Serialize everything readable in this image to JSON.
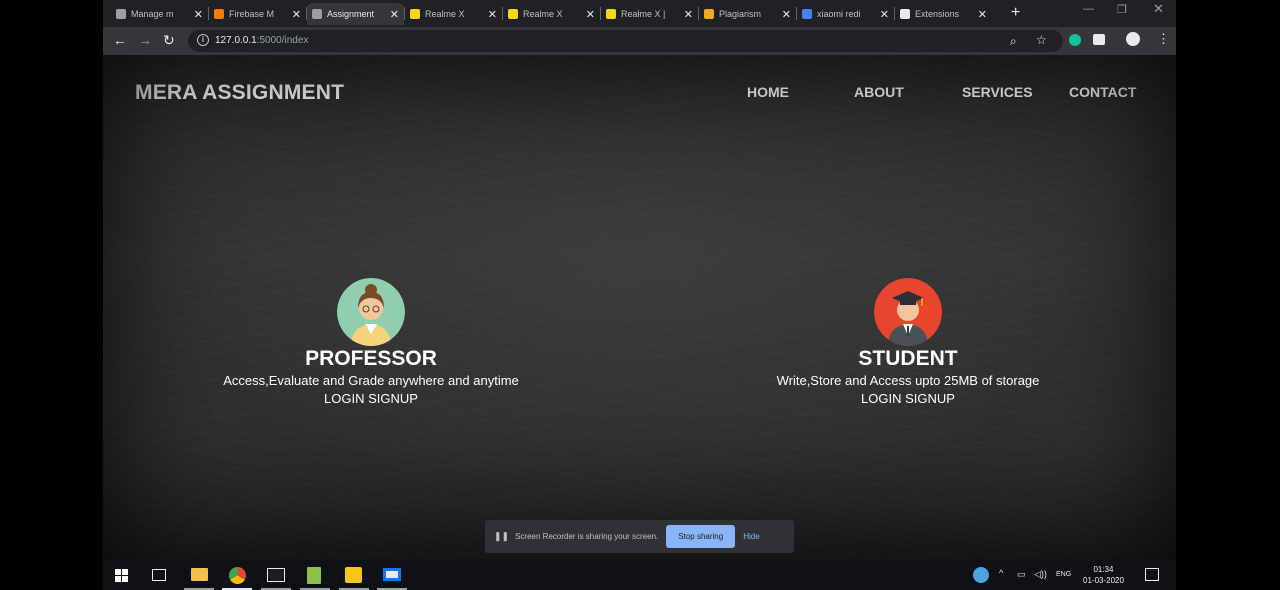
{
  "browser": {
    "tabs": [
      {
        "title": "Manage m",
        "favicon": "globe-icon",
        "color": "#9aa0a6"
      },
      {
        "title": "Firebase M",
        "favicon": "firebase-icon",
        "color": "#f57c00"
      },
      {
        "title": "Assignment",
        "favicon": "globe-icon",
        "color": "#9aa0a6",
        "active": true
      },
      {
        "title": "Realme X",
        "favicon": "realme-icon",
        "color": "#f5d90a"
      },
      {
        "title": "Realme X",
        "favicon": "realme-icon",
        "color": "#f5d90a"
      },
      {
        "title": "Realme X |",
        "favicon": "realme-icon",
        "color": "#f5d90a"
      },
      {
        "title": "Plagiarism",
        "favicon": "plagiarism-icon",
        "color": "#f5a623"
      },
      {
        "title": "xiaomi redi",
        "favicon": "google-icon",
        "color": "#4285f4"
      },
      {
        "title": "Extensions",
        "favicon": "puzzle-icon",
        "color": "#e8eaed"
      }
    ],
    "url_host": "127.0.0.1",
    "url_rest": ":5000/index"
  },
  "site": {
    "brand": "MERA ASSIGNMENT",
    "menu": [
      "HOME",
      "ABOUT",
      "SERVICES",
      "CONTACT"
    ],
    "professor": {
      "title": "PROFESSOR",
      "description": "Access,Evaluate and Grade anywhere and anytime",
      "login": "LOGIN",
      "signup": "SIGNUP"
    },
    "student": {
      "title": "STUDENT",
      "description": "Write,Store and Access upto 25MB of storage",
      "login": "LOGIN",
      "signup": "SIGNUP"
    }
  },
  "share_bar": {
    "message": "Screen Recorder is sharing your screen.",
    "stop_label": "Stop sharing",
    "hide_label": "Hide"
  },
  "taskbar": {
    "lang": "ENG",
    "time": "01:34",
    "date": "01-03-2020"
  }
}
